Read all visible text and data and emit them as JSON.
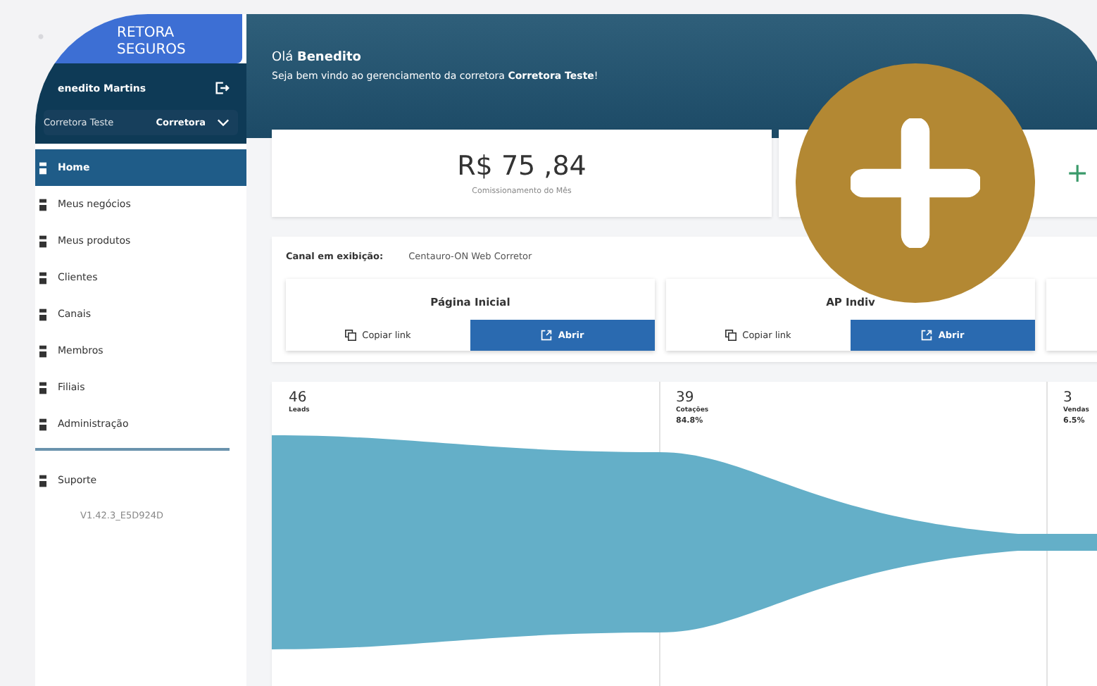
{
  "sidebar": {
    "logo_lines": [
      "RETORA",
      "SEGUROS"
    ],
    "user": {
      "name": "enedito Martins"
    },
    "company": {
      "name": "Corretora Teste",
      "role": "Corretora"
    },
    "items": [
      {
        "label": "Home",
        "selected": true
      },
      {
        "label": "Meus negócios",
        "selected": false
      },
      {
        "label": "Meus produtos",
        "selected": false
      },
      {
        "label": "Clientes",
        "selected": false
      },
      {
        "label": "Canais",
        "selected": false
      },
      {
        "label": "Membros",
        "selected": false
      },
      {
        "label": "Filiais",
        "selected": false
      },
      {
        "label": "Administração",
        "selected": false
      }
    ],
    "support": "Suporte",
    "version": "V1.42.3_E5D924D"
  },
  "header": {
    "greeting": "Olá **Benedito**",
    "subtitle": "Seja bem vindo ao gerenciamento da corretora **Corretora Teste**!"
  },
  "stats": [
    {
      "value": "R$ 75 ,84",
      "label": "Comissionamento do Mês"
    },
    {
      "value": "+"
    }
  ],
  "channel": {
    "label": "Canal em exibição:",
    "value": "Centauro-ON Web Corretor",
    "cards": [
      {
        "title": "Página Inicial",
        "copy": "Copiar link",
        "open": "Abrir"
      },
      {
        "title": "AP Indiv",
        "copy": "Copiar link",
        "open": "Abrir"
      }
    ]
  },
  "funnel": {
    "stages": [
      {
        "count": "46",
        "name": "Leads"
      },
      {
        "count": "39",
        "name": "Cotações",
        "percent": "84.8%"
      },
      {
        "count": "3",
        "name": "Vendas",
        "percent": "6.5%"
      }
    ]
  }
}
